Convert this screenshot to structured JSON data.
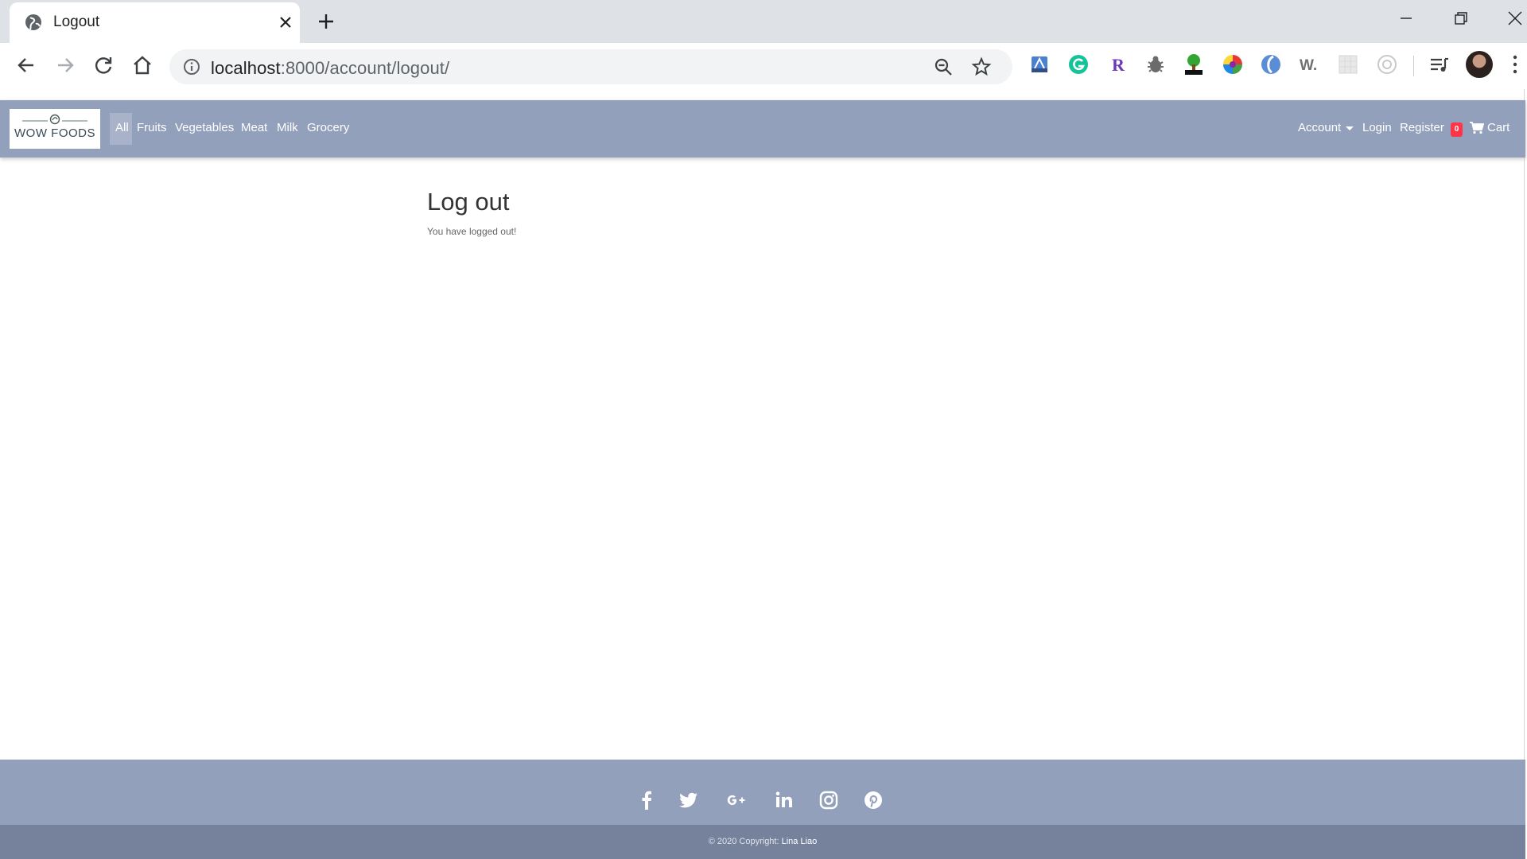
{
  "browser": {
    "tab": {
      "title": "Logout"
    },
    "url": {
      "host": "localhost",
      "rest": ":8000/account/logout/"
    },
    "extensions": [
      "tape-extension-icon",
      "grammarly-extension-icon",
      "r-extension-icon",
      "bug-extension-icon",
      "html-tree-extension-icon",
      "color-wheel-extension-icon",
      "blue-swirl-extension-icon",
      "w-extension-icon",
      "grid-extension-icon",
      "circle-extension-icon"
    ],
    "extension_w_label": "W.",
    "extension_r_label": "R"
  },
  "site": {
    "logo_text": "WOW FOODS",
    "nav": {
      "categories": [
        "All",
        "Fruits",
        "Vegetables",
        "Meat",
        "Milk",
        "Grocery"
      ],
      "account_label": "Account",
      "login_label": "Login",
      "register_label": "Register",
      "cart_count": "0",
      "cart_label": "Cart"
    },
    "main": {
      "heading": "Log out",
      "message": "You have logged out!"
    },
    "footer": {
      "social_icons": [
        "facebook-icon",
        "twitter-icon",
        "google-plus-icon",
        "linkedin-icon",
        "instagram-icon",
        "pinterest-icon"
      ],
      "copyright_prefix": "© 2020 Copyright:",
      "copyright_author": "Lina Liao"
    }
  },
  "colors": {
    "navbar": "#93a0bc",
    "footer_bottom": "#76829c",
    "badge": "#ff3547"
  }
}
